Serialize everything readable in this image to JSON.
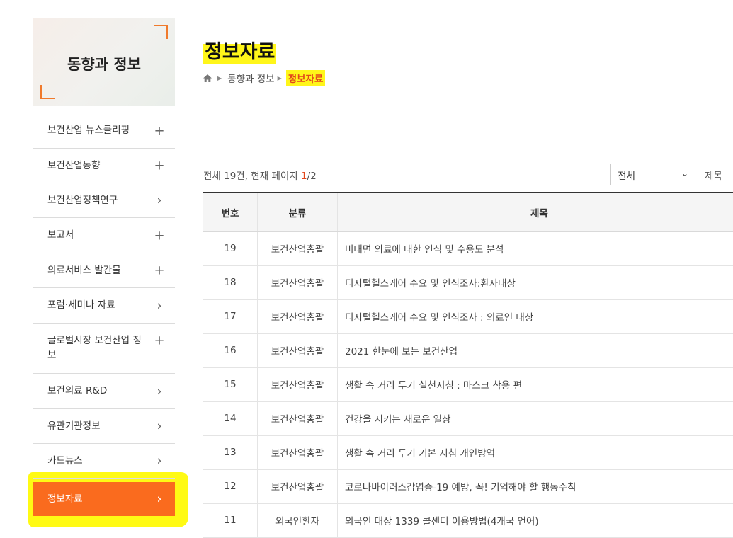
{
  "sidebar": {
    "title": "동향과 정보",
    "items": [
      {
        "label": "보건산업 뉴스클리핑",
        "icon": "+"
      },
      {
        "label": "보건산업동향",
        "icon": "+"
      },
      {
        "label": "보건산업정책연구",
        "icon": "›"
      },
      {
        "label": "보고서",
        "icon": "+"
      },
      {
        "label": "의료서비스 발간물",
        "icon": "+"
      },
      {
        "label": "포럼·세미나 자료",
        "icon": "›"
      },
      {
        "label": "글로벌시장 보건산업 정보",
        "icon": "+"
      },
      {
        "label": "보건의료 R&D",
        "icon": "›"
      },
      {
        "label": "유관기관정보",
        "icon": "›"
      },
      {
        "label": "카드뉴스",
        "icon": "›"
      },
      {
        "label": "정보자료",
        "icon": "›"
      }
    ]
  },
  "page": {
    "title": "정보자료",
    "breadcrumb": [
      "동향과 정보",
      "정보자료"
    ]
  },
  "list": {
    "count_text": "전체 19건, 현재 페이지 ",
    "page_current": "1",
    "page_total": "/2",
    "category_select": "전체",
    "field_select": "제목",
    "headers": [
      "번호",
      "분류",
      "제목"
    ],
    "rows": [
      {
        "no": "19",
        "cat": "보건산업총괄",
        "title": "비대면 의료에 대한 인식 및 수용도 분석"
      },
      {
        "no": "18",
        "cat": "보건산업총괄",
        "title": "디지털헬스케어 수요 및 인식조사:환자대상"
      },
      {
        "no": "17",
        "cat": "보건산업총괄",
        "title": "디지털헬스케어 수요 및 인식조사 : 의료인 대상"
      },
      {
        "no": "16",
        "cat": "보건산업총괄",
        "title": "2021 한눈에 보는 보건산업"
      },
      {
        "no": "15",
        "cat": "보건산업총괄",
        "title": "생활 속 거리 두기 실천지침 : 마스크 착용 편"
      },
      {
        "no": "14",
        "cat": "보건산업총괄",
        "title": "건강을 지키는 새로운 일상"
      },
      {
        "no": "13",
        "cat": "보건산업총괄",
        "title": "생활 속 거리 두기 기본 지침 개인방역"
      },
      {
        "no": "12",
        "cat": "보건산업총괄",
        "title": "코로나바이러스감염증-19 예방, 꼭! 기억해야 할 행동수칙"
      },
      {
        "no": "11",
        "cat": "외국인환자",
        "title": "외국인 대상 1339 콜센터 이용방법(4개국 언어)"
      }
    ]
  },
  "colors": {
    "accent": "#fa6b1e",
    "highlight": "#fff61a",
    "highlight_text": "#e2461b"
  }
}
